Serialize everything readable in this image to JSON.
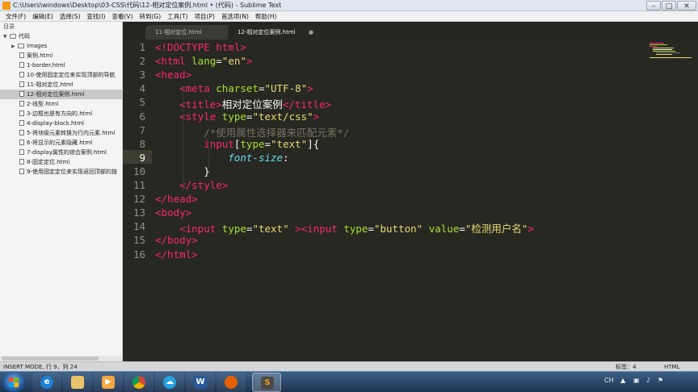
{
  "window": {
    "title": "C:\\Users\\windows\\Desktop\\03-CSS\\代码\\12-相对定位案例.html • (代码) - Sublime Text"
  },
  "menu": [
    "文件(F)",
    "编辑(E)",
    "选择(S)",
    "查找(I)",
    "查看(V)",
    "转到(G)",
    "工具(T)",
    "项目(P)",
    "首选项(N)",
    "帮助(H)"
  ],
  "sidebar": {
    "title": "目录",
    "root": "代码",
    "folders": [
      "images"
    ],
    "files": [
      "案例.html",
      "1-border.html",
      "10-使用固定定位来实现顶部的导航",
      "11-相对定位.html",
      "12-相对定位案例.html",
      "2-线型.html",
      "3-边框也是有方向的.html",
      "4-display-block.html",
      "5-将块级元素转换为行内元素.html",
      "6-将显示的元素隐藏.html",
      "7-display属性的综合案例.html",
      "8-固定定位.html",
      "9-使用固定定位来实现返回顶部的按"
    ],
    "selected_index": 4
  },
  "tabs": [
    {
      "label": "11-相对定位.html",
      "close": "×"
    },
    {
      "label": "12-相对定位案例.html",
      "close": "●"
    }
  ],
  "editor": {
    "current_line": 9,
    "lines": [
      [
        [
          "tag",
          "<!DOCTYPE html>"
        ]
      ],
      [
        [
          "tag",
          "<html "
        ],
        [
          "attr",
          "lang"
        ],
        [
          "pun",
          "="
        ],
        [
          "str",
          "\"en\""
        ],
        [
          "tag",
          ">"
        ]
      ],
      [
        [
          "tag",
          "<head>"
        ]
      ],
      [
        [
          "pun",
          "    "
        ],
        [
          "tag",
          "<meta "
        ],
        [
          "attr",
          "charset"
        ],
        [
          "pun",
          "="
        ],
        [
          "str",
          "\"UTF-8\""
        ],
        [
          "tag",
          ">"
        ]
      ],
      [
        [
          "pun",
          "    "
        ],
        [
          "tag",
          "<title>"
        ],
        [
          "pun",
          "相对定位案例"
        ],
        [
          "tag",
          "</title>"
        ]
      ],
      [
        [
          "pun",
          "    "
        ],
        [
          "tag",
          "<style "
        ],
        [
          "attr",
          "type"
        ],
        [
          "pun",
          "="
        ],
        [
          "str",
          "\"text/css\""
        ],
        [
          "tag",
          ">"
        ]
      ],
      [
        [
          "pun",
          "        "
        ],
        [
          "cm",
          "/*使用属性选择器来匹配元素*/"
        ]
      ],
      [
        [
          "pun",
          "        "
        ],
        [
          "tag",
          "input"
        ],
        [
          "pun",
          "["
        ],
        [
          "attr",
          "type"
        ],
        [
          "pun",
          "="
        ],
        [
          "str",
          "\"text\""
        ],
        [
          "pun",
          "]{"
        ]
      ],
      [
        [
          "pun",
          "            "
        ],
        [
          "prop",
          "font-size"
        ],
        [
          "pun",
          ":"
        ]
      ],
      [
        [
          "pun",
          "        }"
        ]
      ],
      [
        [
          "pun",
          "    "
        ],
        [
          "tag",
          "</style>"
        ]
      ],
      [
        [
          "tag",
          "</head>"
        ]
      ],
      [
        [
          "tag",
          "<body>"
        ]
      ],
      [
        [
          "pun",
          "    "
        ],
        [
          "tag",
          "<input "
        ],
        [
          "attr",
          "type"
        ],
        [
          "pun",
          "="
        ],
        [
          "str",
          "\"text\""
        ],
        [
          "pun",
          " "
        ],
        [
          "tag",
          "><input "
        ],
        [
          "attr",
          "type"
        ],
        [
          "pun",
          "="
        ],
        [
          "str",
          "\"button\""
        ],
        [
          "pun",
          " "
        ],
        [
          "attr",
          "value"
        ],
        [
          "pun",
          "="
        ],
        [
          "str",
          "\"检测用户名\""
        ],
        [
          "tag",
          ">"
        ]
      ],
      [
        [
          "tag",
          "</body>"
        ]
      ],
      [
        [
          "tag",
          "</html>"
        ]
      ]
    ]
  },
  "status": {
    "left": "INSERT MODE, 行 9，列 24",
    "tab_size": "标签：4",
    "syntax": "HTML"
  },
  "taskbar": {
    "clock": "",
    "tray": [
      "CH"
    ]
  },
  "colors": {
    "editor_bg": "#272822",
    "tag": "#f92672",
    "attr": "#a6e22e",
    "string": "#e6db74",
    "comment": "#75715e",
    "property": "#66d9ef"
  }
}
